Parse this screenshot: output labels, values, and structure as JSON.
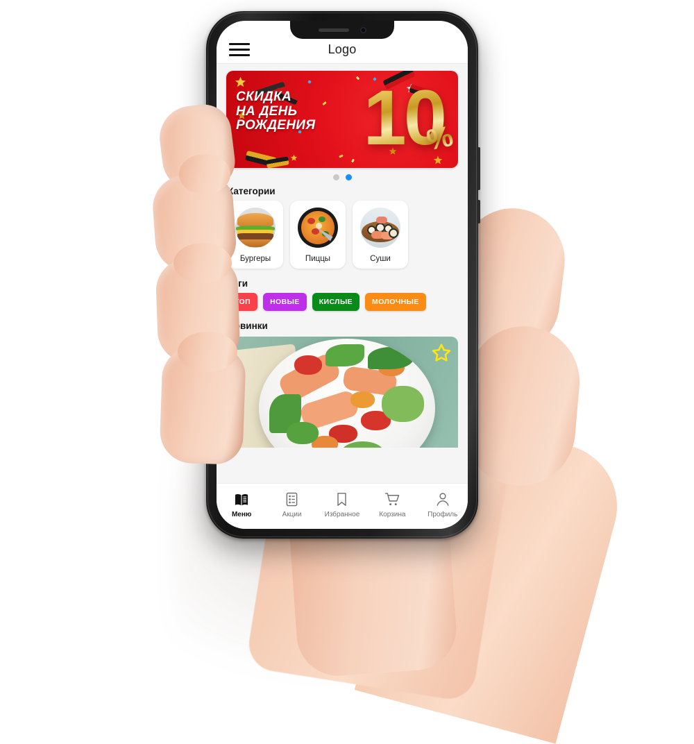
{
  "device": {
    "type": "smartphone-mockup",
    "orientation": "portrait",
    "held_by": "right-hand"
  },
  "app": {
    "header": {
      "menu_icon": "hamburger-icon",
      "title": "Logo"
    },
    "banner": {
      "line1": "СКИДКА",
      "line2": "НА ДЕНЬ",
      "line3": "РОЖДЕНИЯ",
      "amount": "10",
      "percent": "%",
      "background_color": "#e2101a",
      "text_color": "#ffffff",
      "number_color": "#d4a62c"
    },
    "carousel": {
      "total_slides": 2,
      "active_index": 1,
      "active_color": "#1a90ff",
      "inactive_color": "#c9c9c9"
    },
    "categories": {
      "title": "Категории",
      "items": [
        {
          "label": "Бургеры",
          "image": "burger-photo"
        },
        {
          "label": "Пиццы",
          "image": "pizza-photo"
        },
        {
          "label": "Суши",
          "image": "sushi-photo"
        }
      ]
    },
    "tags": {
      "title": "Теги",
      "items": [
        {
          "label": "ТОП",
          "color": "#f8414a"
        },
        {
          "label": "НОВЫЕ",
          "color": "#bf2ee8"
        },
        {
          "label": "КИСЛЫЕ",
          "color": "#0a8a18"
        },
        {
          "label": "МОЛОЧНЫЕ",
          "color": "#fa8c16"
        }
      ]
    },
    "novelties": {
      "title": "Новинки",
      "card": {
        "image": "salmon-salad-photo",
        "favorite_icon": "star-outline-icon",
        "favorite_color": "#ffe414"
      }
    },
    "bottom_nav": {
      "items": [
        {
          "label": "Меню",
          "icon": "open-book-icon",
          "active": true
        },
        {
          "label": "Акции",
          "icon": "list-icon",
          "active": false
        },
        {
          "label": "Избранное",
          "icon": "bookmark-icon",
          "active": false
        },
        {
          "label": "Корзина",
          "icon": "cart-icon",
          "active": false
        },
        {
          "label": "Профиль",
          "icon": "person-icon",
          "active": false
        }
      ]
    }
  }
}
